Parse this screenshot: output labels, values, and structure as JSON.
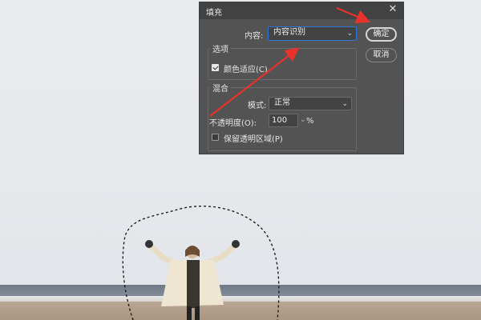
{
  "dialog": {
    "title": "填充",
    "close_glyph": "✕",
    "content_label": "内容:",
    "content_value": "内容识别",
    "options_group": "选项",
    "color_adapt_label": "颜色适应(C)",
    "color_adapt_checked": true,
    "blend_group": "混合",
    "mode_label": "模式:",
    "mode_value": "正常",
    "opacity_label": "不透明度(O):",
    "opacity_value": "100",
    "opacity_unit": "%",
    "preserve_label": "保留透明区域(P)",
    "preserve_checked": false,
    "ok_label": "确定",
    "cancel_label": "取消"
  },
  "colors": {
    "dialog_bg": "#535353",
    "titlebar_bg": "#424242",
    "annotation_arrow": "#e8322b",
    "focus_border": "#2f77d6"
  },
  "icons": {
    "close": "close-icon",
    "dropdown": "chevron-down-icon",
    "checkbox": "checkmark-icon"
  }
}
